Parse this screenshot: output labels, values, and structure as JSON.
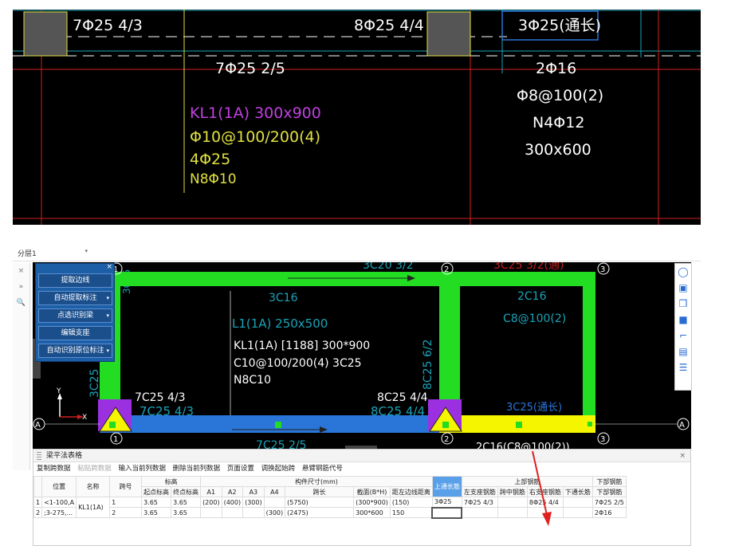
{
  "cad_top": {
    "labels": {
      "tl": "7Φ25 4/3",
      "tm": "8Φ25 4/4",
      "tr": "3Φ25(通长)",
      "bl": "7Φ25 2/5",
      "br": "2Φ16",
      "stir_r": "Φ8@100(2)",
      "n_r": "N4Φ12",
      "size_r": "300x600",
      "kl_name": "KL1(1A) 300x900",
      "kl_stir": "Φ10@100/200(4)",
      "kl_top": "4Φ25",
      "kl_n": "N8Φ10"
    }
  },
  "app": {
    "layer_select": "分层1",
    "left_strip": [
      "×",
      "»",
      "🔍"
    ],
    "panel": {
      "close": "×",
      "buttons": [
        "提取边线",
        "自动提取标注",
        "点选识别梁",
        "编辑支座",
        "自动识别原位标注"
      ]
    },
    "viewport": {
      "grid_labels": {
        "1": "1",
        "2": "2",
        "3": "3",
        "A": "A"
      },
      "overlay_text_1": "KL1(1A) [1188] 300*900",
      "overlay_text_2": "C10@100/200(4) 3C25",
      "overlay_text_3": "N8C10",
      "left_pos": "7C25 4/3",
      "mid_pos": "8C25 4/4",
      "faded_l1": "L1(1A) 250x500",
      "faded_3c16": "3C16",
      "faded_2c16": "2C16",
      "faded_c8": "C8@100(2)",
      "faded_3c25": "3C25(通长)",
      "faded_3c25top": "3C25 3/2(通)",
      "faded_bottom_mid": "7C25 2/5",
      "faded_bottom_r": "2C16(C8@100(2))",
      "faded_col_label": "3C25",
      "faded_col_mid": "8C25 6/2",
      "faded_top_left": "3C25",
      "faded_3c20": "3C20 3/2",
      "faded_c25_l": "7C25 4/3",
      "faded_c25_m": "8C25 4/4",
      "faded_3c25_r": "3C25(通长)"
    },
    "table": {
      "title": "梁平法表格",
      "menu": [
        "复制跨数据",
        "粘贴跨数据",
        "输入当前列数据",
        "删除当前列数据",
        "页面设置",
        "调换起始跨",
        "悬臂钢筋代号"
      ],
      "menu_disabled": [
        false,
        true,
        false,
        false,
        false,
        false,
        false
      ],
      "header_top": {
        "biaogao": "标高",
        "size": "构件尺寸(mm)",
        "top": "上部钢筋",
        "bottom": "下部钢筋"
      },
      "headers": [
        "位置",
        "名称",
        "跨号",
        "起点标高",
        "终点标高",
        "A1",
        "A2",
        "A3",
        "A4",
        "跨长",
        "截面(B*H)",
        "距左边线距离",
        "上通长筋",
        "左支座钢筋",
        "跨中钢筋",
        "右支座钢筋",
        "下通长筋",
        "下部钢筋"
      ],
      "rows": [
        [
          "<1-100,A",
          "KL1(1A)",
          "1",
          "3.65",
          "3.65",
          "(200)",
          "(400)",
          "(300)",
          "",
          "(5750)",
          "(300*900)",
          "(150)",
          "3Φ25",
          "7Φ25 4/3",
          "",
          "8Φ25 4/4",
          "",
          "7Φ25 2/5"
        ],
        [
          ";3-275,...",
          "",
          "2",
          "3.65",
          "3.65",
          "",
          "",
          "",
          "(300)",
          "(2475)",
          "300*600",
          "150",
          "",
          "",
          "",
          "",
          "",
          "2Φ16"
        ]
      ],
      "row_nums": [
        "1",
        "2"
      ]
    },
    "colors": {
      "green": "#22dd22",
      "blue": "#2a75d8",
      "yellow": "#f5f500",
      "purple": "#9b30e0",
      "cyan": "#1aa3b8"
    }
  }
}
